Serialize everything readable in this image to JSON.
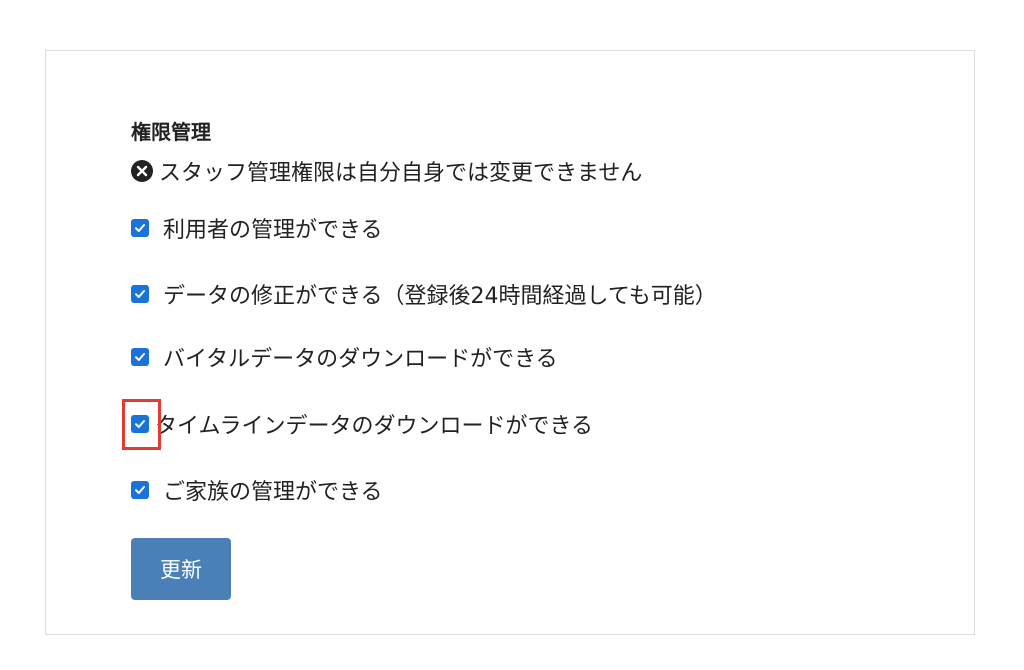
{
  "section": {
    "title": "権限管理"
  },
  "notice": {
    "icon": "close-circle-icon",
    "text": "スタッフ管理権限は自分自身では変更できません"
  },
  "permissions": [
    {
      "label": "利用者の管理ができる",
      "checked": true
    },
    {
      "label": "データの修正ができる（登録後24時間経過しても可能）",
      "checked": true
    },
    {
      "label": "バイタルデータのダウンロードができる",
      "checked": true
    },
    {
      "label": "タイムラインデータのダウンロードができる",
      "checked": true,
      "highlighted": true
    },
    {
      "label": "ご家族の管理ができる",
      "checked": true
    }
  ],
  "actions": {
    "update_label": "更新"
  },
  "colors": {
    "checkbox": "#1a73d9",
    "button": "#4a7fb8",
    "highlight": "#e53935",
    "border": "#dcdcdc"
  }
}
